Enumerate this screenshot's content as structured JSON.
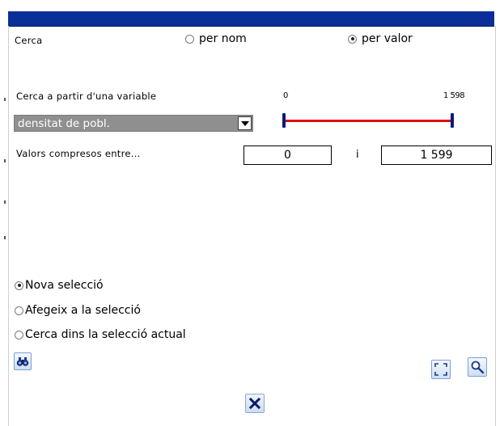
{
  "search": {
    "label": "Cerca",
    "mode_options": [
      {
        "label": "per nom",
        "selected": false
      },
      {
        "label": "per valor",
        "selected": true
      }
    ]
  },
  "variable": {
    "label": "Cerca a partir d'una variable",
    "selected": "densitat de pobl.",
    "slider_min": "0",
    "slider_max": "1 598"
  },
  "range": {
    "label": "Valors compresos entre...",
    "from": "0",
    "conjunction": "i",
    "to": "1 599"
  },
  "selection_mode": {
    "options": [
      {
        "label": "Nova selecció",
        "selected": true
      },
      {
        "label": "Afegeix a la selecció",
        "selected": false
      },
      {
        "label": "Cerca dins la selecció actual",
        "selected": false
      }
    ]
  },
  "colors": {
    "title_bar": "#0a2f99",
    "slider_track": "#e01010",
    "slider_handle": "#0a1a7a",
    "dropdown_bg": "#8f8f8f"
  },
  "icons": {
    "search_button": "binoculars-icon",
    "full_extent_button": "full-extent-icon",
    "zoom_button": "zoom-icon",
    "close_button": "close-icon"
  }
}
